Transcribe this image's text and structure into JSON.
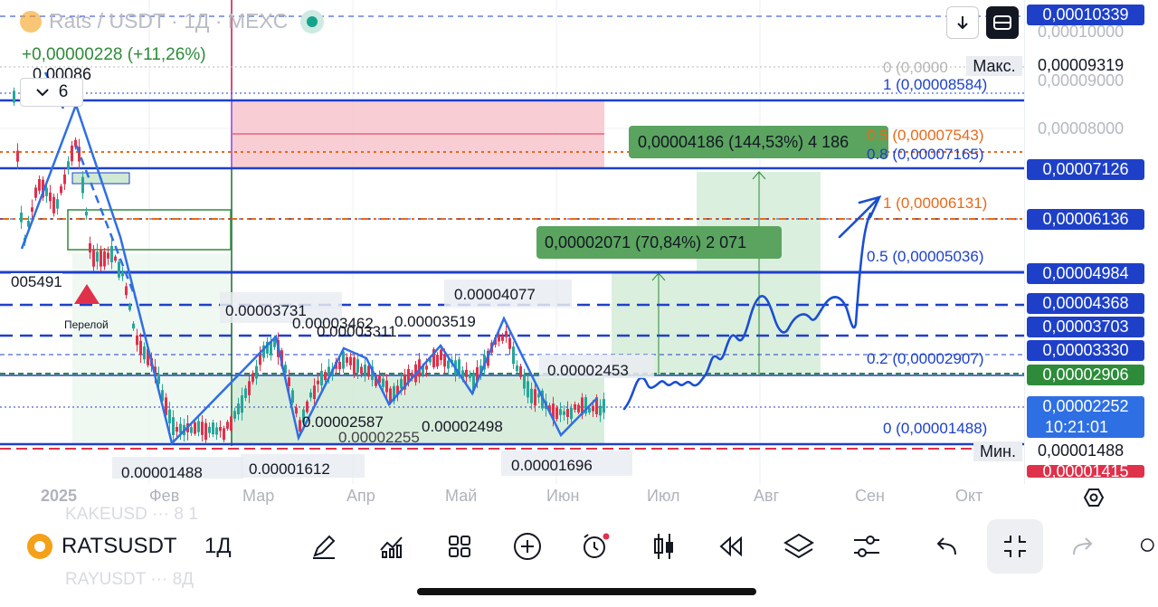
{
  "header": {
    "symbol_title": "Rats / USDT · 1Д · MEXC",
    "change": "+0,00000228 (+11,26%)",
    "pinned_value": "0,00086",
    "indicators_count": "6"
  },
  "price_scale": {
    "labels": [
      {
        "text": "0,00010339",
        "kind": "box",
        "color": "#1e40c9"
      },
      {
        "text": "0,00010000",
        "kind": "plain"
      },
      {
        "text": "0,00009319",
        "kind": "plain-dark"
      },
      {
        "text": "0,00009000",
        "kind": "plain"
      },
      {
        "text": "0,00008000",
        "kind": "plain"
      },
      {
        "text": "0,00007126",
        "kind": "box",
        "color": "#1e40c9"
      },
      {
        "text": "0,00006136",
        "kind": "box",
        "color": "#1e40c9"
      },
      {
        "text": "0,00004984",
        "kind": "box",
        "color": "#1e40c9"
      },
      {
        "text": "0,00004368",
        "kind": "box",
        "color": "#1e40c9"
      },
      {
        "text": "0,00003703",
        "kind": "box",
        "color": "#1e40c9"
      },
      {
        "text": "0,00003330",
        "kind": "box",
        "color": "#1e40c9"
      },
      {
        "text": "0,00002906",
        "kind": "box",
        "color": "#2e8b3a"
      },
      {
        "text": "0,00002252",
        "kind": "box",
        "color": "#2f6fe4"
      },
      {
        "text": "10:21:01",
        "kind": "box",
        "color": "#2f6fe4"
      },
      {
        "text": "0,00001488",
        "kind": "plain-dark"
      },
      {
        "text": "0,00001415",
        "kind": "box",
        "color": "#e0314b"
      }
    ],
    "max_label": "Макс.",
    "min_label": "Мин."
  },
  "fib_levels": [
    {
      "text": "0 (0,0000",
      "color": "#b5b5b5"
    },
    {
      "text": "1 (0,00008584)",
      "color": "#1e40c9"
    },
    {
      "text": "0.5 (0,00007543)",
      "color": "#e86a1a"
    },
    {
      "text": "0.8 (0,00007165)",
      "color": "#1e40c9"
    },
    {
      "text": "1 (0,00006131)",
      "color": "#e86a1a"
    },
    {
      "text": "0.5 (0,00005036)",
      "color": "#1e40c9"
    },
    {
      "text": "0.2 (0,00002907)",
      "color": "#1e40c9"
    },
    {
      "text": "0 (0,00001488)",
      "color": "#1e40c9"
    }
  ],
  "measure_boxes": [
    {
      "text": "0,00004186 (144,53%) 4 186"
    },
    {
      "text": "0,00002071 (70,84%) 2 071"
    }
  ],
  "chart_annotations": [
    "005491",
    "Перелой",
    "0.00003731",
    "0.00003462",
    "0.00003311",
    "0.00003519",
    "0.00004077",
    "0.00002453",
    "0.00002587",
    "0.00002255",
    "0.00002498",
    "0.00001488",
    "0.00001612",
    "0.00001696"
  ],
  "time_axis": [
    "2025",
    "Фев",
    "Мар",
    "Апр",
    "Май",
    "Июн",
    "Июл",
    "Авг",
    "Сен",
    "Окт"
  ],
  "toolbar": {
    "symbol": "RATSUSDT",
    "interval": "1Д",
    "ghost_top": "KAKEUSD ··· 8 1",
    "ghost_bottom": "RAYUSDT ··· 8Д"
  },
  "colors": {
    "brand_blue": "#1e40c9",
    "accent_blue": "#2f6fe4",
    "up_green": "#2e8b3a",
    "down_red": "#e0314b",
    "fib_orange": "#e86a1a"
  }
}
